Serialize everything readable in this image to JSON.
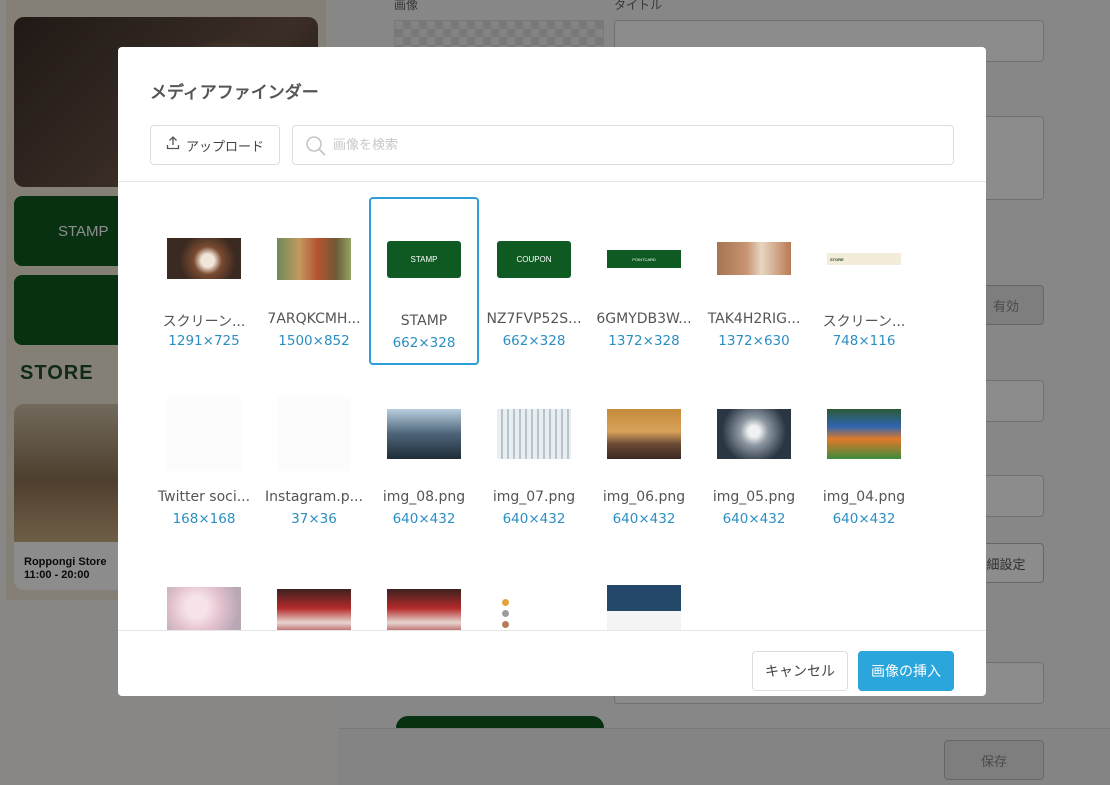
{
  "background": {
    "phone": {
      "stamp_label": "STAMP",
      "store_title": "STORE",
      "store_name": "Roppongi Store",
      "store_hours": "11:00 - 20:00"
    },
    "form": {
      "image_label": "画像",
      "title_label": "タイトル",
      "enabled_button": "有効",
      "detail_settings_button": "細設定",
      "save_button": "保存"
    }
  },
  "modal": {
    "title": "メディアファインダー",
    "upload_label": "アップロード",
    "search_placeholder": "画像を検索",
    "cancel_label": "キャンセル",
    "insert_label": "画像の挿入",
    "accent_color": "#2aa6dc",
    "items": [
      {
        "name": "スクリーン...",
        "dims": "1291×725"
      },
      {
        "name": "7ARQKCMH...",
        "dims": "1500×852"
      },
      {
        "name": "STAMP",
        "dims": "662×328",
        "selected": true,
        "thumb_text": "STAMP"
      },
      {
        "name": "NZ7FVP52S...",
        "dims": "662×328",
        "thumb_text": "COUPON"
      },
      {
        "name": "6GMYDB3W...",
        "dims": "1372×328",
        "thumb_text": "POINTCARD"
      },
      {
        "name": "TAK4H2RIG...",
        "dims": "1372×630"
      },
      {
        "name": "スクリーン...",
        "dims": "748×116",
        "thumb_text": "STORE"
      },
      {
        "name": "Twitter soci...",
        "dims": "168×168"
      },
      {
        "name": "Instagram.p...",
        "dims": "37×36"
      },
      {
        "name": "img_08.png",
        "dims": "640×432"
      },
      {
        "name": "img_07.png",
        "dims": "640×432"
      },
      {
        "name": "img_06.png",
        "dims": "640×432"
      },
      {
        "name": "img_05.png",
        "dims": "640×432"
      },
      {
        "name": "img_04.png",
        "dims": "640×432"
      },
      {
        "name": "",
        "dims": ""
      },
      {
        "name": "",
        "dims": ""
      },
      {
        "name": "",
        "dims": ""
      },
      {
        "name": "",
        "dims": ""
      },
      {
        "name": "",
        "dims": ""
      }
    ]
  }
}
